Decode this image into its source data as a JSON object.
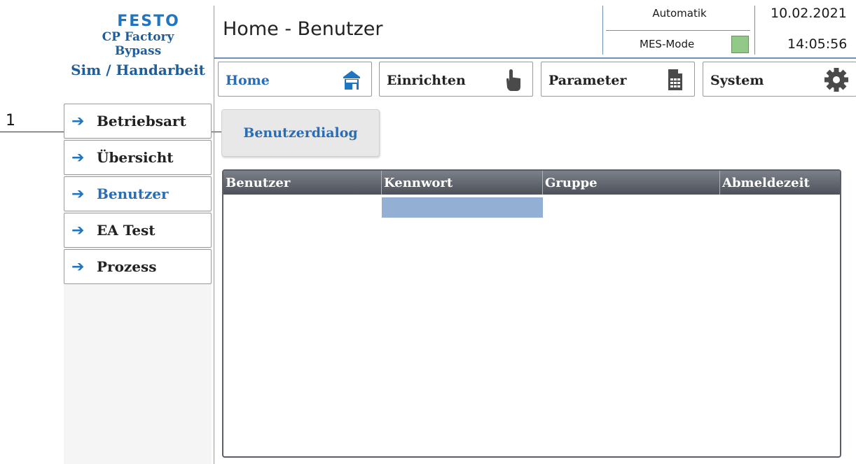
{
  "callout": {
    "number": "1"
  },
  "brand": {
    "logo": "FESTO",
    "line1": "CP Factory",
    "line2": "Bypass",
    "line3": "Sim / Handarbeit"
  },
  "header": {
    "title": "Home - Benutzer",
    "mode": "Automatik",
    "mes_label": "MES-Mode",
    "mes_status_color": "#93c986",
    "date": "10.02.2021",
    "time": "14:05:56"
  },
  "tabs": [
    {
      "label": "Home",
      "icon": "home-icon",
      "active": true
    },
    {
      "label": "Einrichten",
      "icon": "hand-pointer-icon",
      "active": false
    },
    {
      "label": "Parameter",
      "icon": "document-icon",
      "active": false
    },
    {
      "label": "System",
      "icon": "gear-icon",
      "active": false
    }
  ],
  "sidebar": {
    "items": [
      {
        "label": "Betriebsart",
        "active": false
      },
      {
        "label": "Übersicht",
        "active": false
      },
      {
        "label": "Benutzer",
        "active": true
      },
      {
        "label": "EA Test",
        "active": false
      },
      {
        "label": "Prozess",
        "active": false
      }
    ]
  },
  "dialog_button": {
    "label": "Benutzerdialog"
  },
  "table": {
    "columns": [
      "Benutzer",
      "Kennwort",
      "Gruppe",
      "Abmeldezeit"
    ],
    "rows": []
  },
  "colors": {
    "accent": "#1f75c0",
    "active_text": "#2a6db4",
    "header_gradient_top": "#7b8089",
    "header_gradient_bottom": "#4d525a",
    "selection": "#93b0d4"
  }
}
